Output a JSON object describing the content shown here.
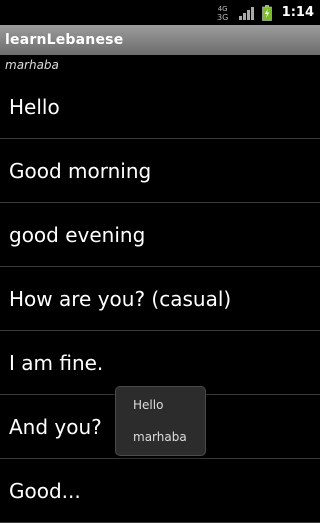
{
  "status_bar": {
    "network_label_top": "4G",
    "network_label_bottom": "3G",
    "time": "1:14",
    "icons": [
      "network-icon",
      "signal-icon",
      "battery-charging-icon"
    ]
  },
  "app": {
    "title": "learnLebanese",
    "subtitle": "marhaba"
  },
  "phrases": [
    "Hello",
    "Good morning",
    "good evening",
    "How are you? (casual)",
    "I am fine.",
    "And you?",
    "Good..."
  ],
  "popup": {
    "english": "Hello",
    "lebanese": "marhaba"
  },
  "colors": {
    "background": "#000000",
    "title_bar": "#8a8a8a",
    "divider": "#3a3a3a",
    "popup_bg": "#2c2c2c"
  }
}
